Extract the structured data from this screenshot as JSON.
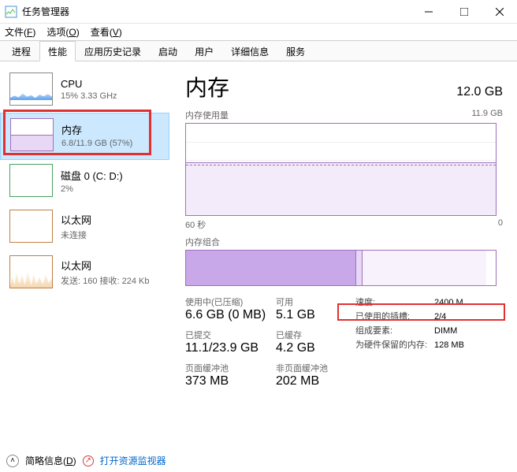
{
  "window": {
    "title": "任务管理器"
  },
  "menu": {
    "file": "文件(<u>F</u>)",
    "options": "选项(<u>O</u>)",
    "view": "查看(<u>V</u>)"
  },
  "tabs": [
    "进程",
    "性能",
    "应用历史记录",
    "启动",
    "用户",
    "详细信息",
    "服务"
  ],
  "tabs_active_index": 1,
  "sidebar": {
    "items": [
      {
        "label": "CPU",
        "sub": "15% 3.33 GHz",
        "thumb": "cpu"
      },
      {
        "label": "内存",
        "sub": "6.8/11.9 GB (57%)",
        "thumb": "mem",
        "selected": true
      },
      {
        "label": "磁盘 0 (C: D:)",
        "sub": "2%",
        "thumb": "disk"
      },
      {
        "label": "以太网",
        "sub": "未连接",
        "thumb": "eth1"
      },
      {
        "label": "以太网",
        "sub": "发送: 160 接收: 224 Kb",
        "thumb": "eth2"
      }
    ]
  },
  "main": {
    "title": "内存",
    "total": "12.0 GB",
    "usage_chart": {
      "label": "内存使用量",
      "max_label": "11.9 GB",
      "x_left": "60 秒",
      "x_right": "0",
      "fill_pct": 57
    },
    "composition": {
      "label": "内存组合"
    },
    "metrics": {
      "in_use_label": "使用中(已压缩)",
      "in_use_val": "6.6 GB (0 MB)",
      "avail_label": "可用",
      "avail_val": "5.1 GB",
      "committed_label": "已提交",
      "committed_val": "11.1/23.9 GB",
      "cached_label": "已缓存",
      "cached_val": "4.2 GB",
      "paged_label": "页面缓冲池",
      "paged_val": "373 MB",
      "nonpaged_label": "非页面缓冲池",
      "nonpaged_val": "202 MB"
    },
    "specs": {
      "speed_k": "速度:",
      "speed_v": "2400 M…",
      "slots_k": "已使用的插槽:",
      "slots_v": "2/4",
      "form_k": "组成要素:",
      "form_v": "DIMM",
      "reserved_k": "为硬件保留的内存:",
      "reserved_v": "128 MB"
    }
  },
  "footer": {
    "brief": "简略信息(<u>D</u>)",
    "resmon": "打开资源监视器"
  }
}
